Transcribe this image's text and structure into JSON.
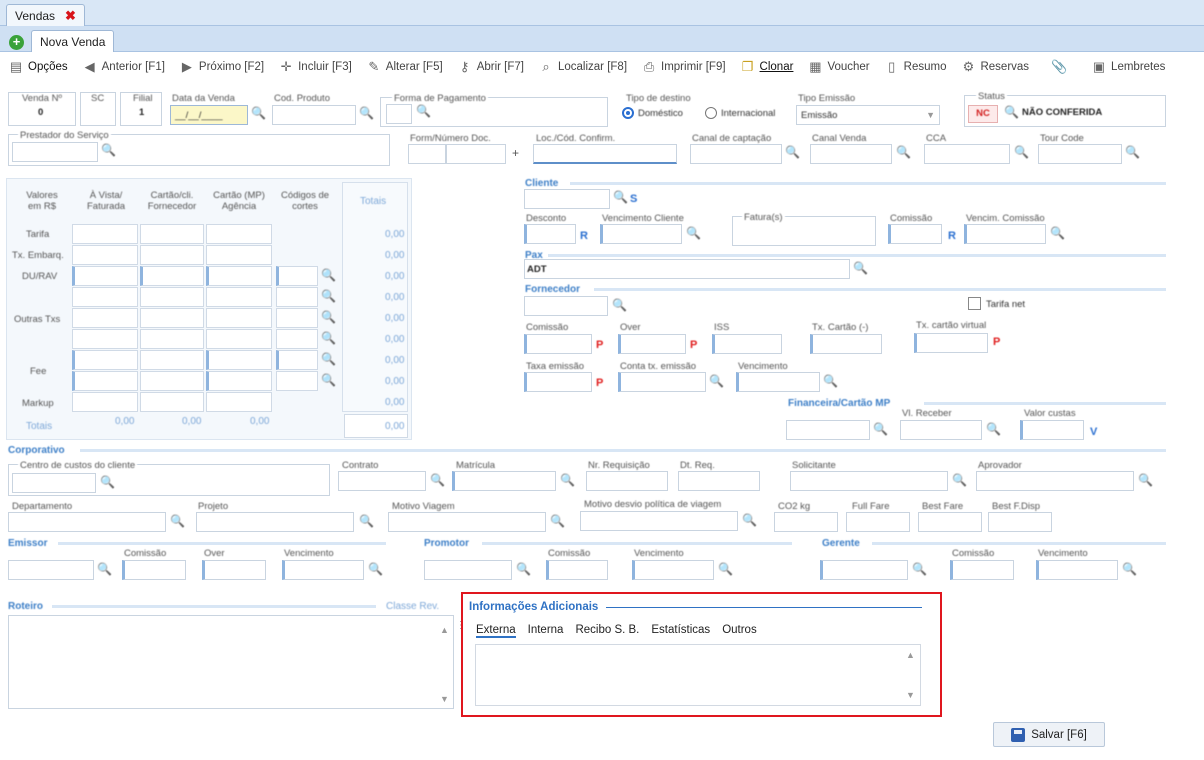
{
  "tabs": {
    "main": "Vendas",
    "sub": "Nova Venda"
  },
  "toolbar": {
    "opcoes": "Opções",
    "anterior": "Anterior [F1]",
    "proximo": "Próximo [F2]",
    "incluir": "Incluir [F3]",
    "alterar": "Alterar [F5]",
    "abrir": "Abrir [F7]",
    "localizar": "Localizar [F8]",
    "imprimir": "Imprimir [F9]",
    "clonar": "Clonar",
    "voucher": "Voucher",
    "resumo": "Resumo",
    "reservas": "Reservas",
    "lembretes": "Lembretes"
  },
  "header": {
    "venda_n": "Venda Nº",
    "venda_n_val": "0",
    "sc": "SC",
    "filial": "Filial",
    "filial_val": "1",
    "data_venda": "Data da Venda",
    "data_venda_val": "__/__/____",
    "cod_produto": "Cod. Produto",
    "forma_pagamento": "Forma de Pagamento",
    "tipo_destino": "Tipo de destino",
    "domestico": "Doméstico",
    "internacional": "Internacional",
    "tipo_emissao": "Tipo Emissão",
    "tipo_emissao_val": "Emissão",
    "status": "Status",
    "status_code": "NC",
    "status_val": "NÃO CONFERIDA",
    "prestador": "Prestador do Serviço",
    "form_numero": "Form/Número Doc.",
    "loc_cod": "Loc./Cód. Confirm.",
    "canal_captacao": "Canal de captação",
    "canal_venda": "Canal Venda",
    "cca": "CCA",
    "tour_code": "Tour Code"
  },
  "values_grid": {
    "corner": "Valores em R$",
    "columns": [
      "À Vista/ Faturada",
      "Cartão/cli. Fornecedor",
      "Cartão (MP) Agência",
      "Códigos de cortes"
    ],
    "totals_header": "Totais",
    "rows": [
      "Tarifa",
      "Tx. Embarq.",
      "DU/RAV",
      "Outras Txs",
      "Fee",
      "Markup"
    ],
    "totals_row_label": "Totais",
    "totals_values": [
      "0,00",
      "0,00",
      "0,00",
      "0,00",
      "0,00",
      "0,00",
      "0,00",
      "0,00",
      "0,00",
      "0,00"
    ],
    "bottom_totals": [
      "0,00",
      "0,00",
      "0,00"
    ],
    "bottom_grand_total": "0,00"
  },
  "cliente": {
    "title": "Cliente",
    "s_flag": "S",
    "desconto": "Desconto",
    "r_flag": "R",
    "vencimento_cliente": "Vencimento Cliente",
    "faturas": "Fatura(s)",
    "comissao": "Comissão",
    "vencim_comissao": "Vencim. Comissão"
  },
  "pax": {
    "title": "Pax",
    "value": "ADT"
  },
  "fornecedor": {
    "title": "Fornecedor",
    "tarifa_net": "Tarifa net",
    "comissao": "Comissão",
    "over": "Over",
    "iss": "ISS",
    "tx_cartao": "Tx. Cartão (-)",
    "tx_cartao_virtual": "Tx. cartão virtual",
    "p_flag": "P",
    "taxa_emissao": "Taxa emissão",
    "conta_tx_emissao": "Conta tx. emissão",
    "vencimento": "Vencimento"
  },
  "financeira": {
    "title": "Financeira/Cartão MP",
    "vl_receber": "Vl. Receber",
    "valor_custas": "Valor custas",
    "v_flag": "V"
  },
  "corporativo": {
    "title": "Corporativo",
    "centro_custos": "Centro de custos do cliente",
    "contrato": "Contrato",
    "matricula": "Matrícula",
    "nr_requisicao": "Nr. Requisição",
    "dt_req": "Dt. Req.",
    "solicitante": "Solicitante",
    "aprovador": "Aprovador",
    "departamento": "Departamento",
    "projeto": "Projeto",
    "motivo_viagem": "Motivo Viagem",
    "motivo_desvio": "Motivo desvio política de viagem",
    "co2": "CO2 kg",
    "full_fare": "Full Fare",
    "best_fare": "Best Fare",
    "best_f_disp": "Best F.Disp"
  },
  "emissor": {
    "title": "Emissor",
    "comissao": "Comissão",
    "over": "Over",
    "vencimento": "Vencimento"
  },
  "promotor": {
    "title": "Promotor",
    "comissao": "Comissão",
    "vencimento": "Vencimento"
  },
  "gerente": {
    "title": "Gerente",
    "comissao": "Comissão",
    "vencimento": "Vencimento"
  },
  "roteiro": {
    "title": "Roteiro",
    "classe": "Classe Rev."
  },
  "info": {
    "title": "Informações Adicionais",
    "tabs": [
      "Externa",
      "Interna",
      "Recibo S. B.",
      "Estatísticas",
      "Outros"
    ]
  },
  "save": {
    "label": "Salvar [F6]"
  }
}
